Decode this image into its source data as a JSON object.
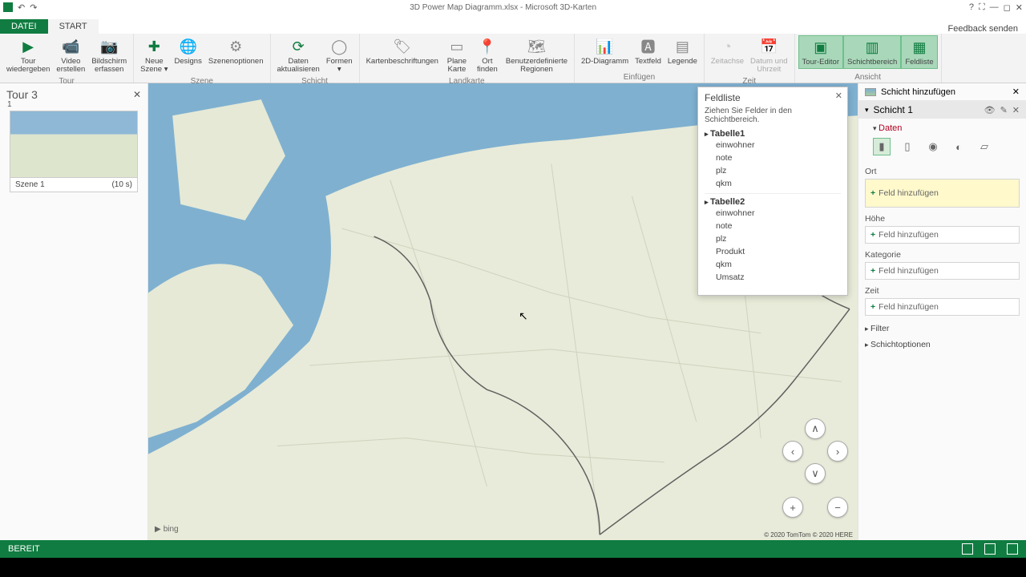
{
  "title": "3D Power Map Diagramm.xlsx - Microsoft 3D-Karten",
  "feedback": "Feedback senden",
  "tabs": {
    "file": "DATEI",
    "start": "START"
  },
  "ribbon": {
    "tour": {
      "label": "Tour",
      "play": "Tour\nwiedergeben",
      "video": "Video\nerstellen",
      "screenshot": "Bildschirm\nerfassen"
    },
    "scene": {
      "label": "Szene",
      "new": "Neue\nSzene ▾",
      "designs": "Designs",
      "options": "Szenenoptionen"
    },
    "layer": {
      "label": "Schicht",
      "refresh": "Daten\naktualisieren",
      "shapes": "Formen\n▾"
    },
    "map": {
      "label": "Landkarte",
      "labels": "Kartenbeschriftungen",
      "flat": "Plane\nKarte",
      "find": "Ort\nfinden",
      "regions": "Benutzerdefinierte\nRegionen"
    },
    "insert": {
      "label": "Einfügen",
      "chart2d": "2D-Diagramm",
      "textbox": "Textfeld",
      "legend": "Legende"
    },
    "time": {
      "label": "Zeit",
      "timeline": "Zeitachse",
      "datetime": "Datum und\nUhrzeit"
    },
    "view": {
      "label": "Ansicht",
      "toureditor": "Tour-Editor",
      "layerpane": "Schichtbereich",
      "fieldlist": "Feldliste"
    }
  },
  "tour_panel": {
    "title": "Tour 3",
    "scene_num": "1",
    "scene_name": "Szene 1",
    "scene_dur": "(10 s)"
  },
  "field_list": {
    "title": "Feldliste",
    "sub": "Ziehen Sie Felder in den Schichtbereich.",
    "tables": [
      {
        "name": "Tabelle1",
        "fields": [
          "einwohner",
          "note",
          "plz",
          "qkm"
        ]
      },
      {
        "name": "Tabelle2",
        "fields": [
          "einwohner",
          "note",
          "plz",
          "Produkt",
          "qkm",
          "Umsatz"
        ]
      }
    ]
  },
  "layer_panel": {
    "add": "Schicht hinzufügen",
    "layer_name": "Schicht 1",
    "data": "Daten",
    "slots": {
      "ort": "Ort",
      "hoehe": "Höhe",
      "kategorie": "Kategorie",
      "zeit": "Zeit",
      "add_field": "Feld hinzufügen"
    },
    "filter": "Filter",
    "options": "Schichtoptionen"
  },
  "status": "BEREIT",
  "credits": {
    "bing": "bing",
    "right": "© 2020 TomTom © 2020 HERE"
  }
}
